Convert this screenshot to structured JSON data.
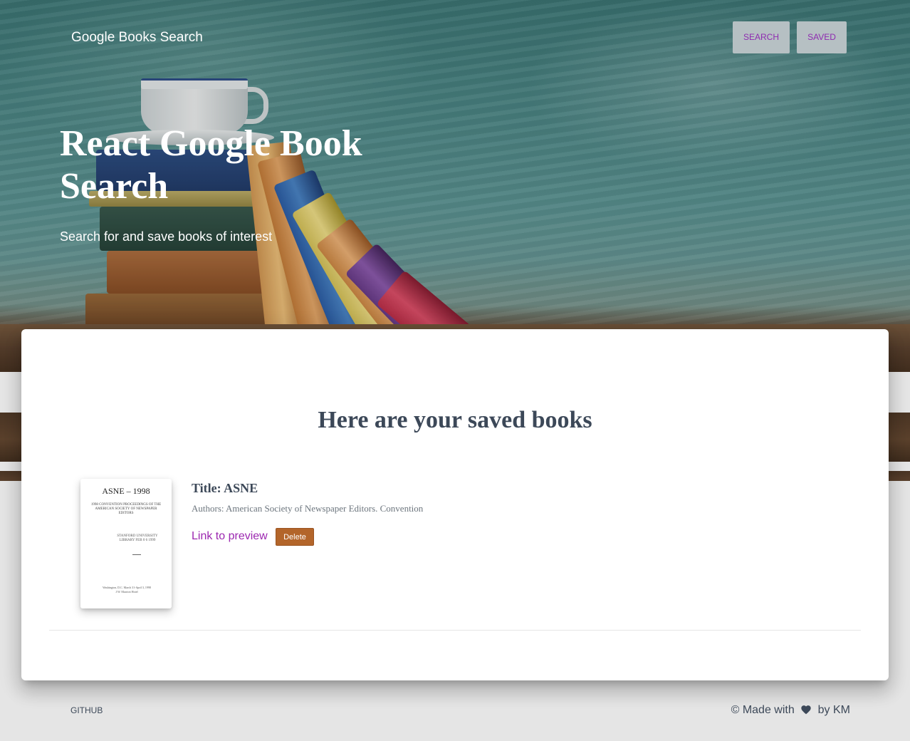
{
  "nav": {
    "brand": "Google Books Search",
    "links": [
      {
        "label": "SEARCH"
      },
      {
        "label": "SAVED"
      }
    ]
  },
  "hero": {
    "title": "React Google Book Search",
    "subtitle": "Search for and save books of interest"
  },
  "saved": {
    "heading": "Here are your saved books",
    "books": [
      {
        "title": "Title: ASNE",
        "authors": "Authors: American Society of Newspaper Editors. Convention",
        "preview_label": "Link to preview",
        "delete_label": "Delete",
        "thumbnail": {
          "title": "ASNE – 1998",
          "subtitle": "1998 CONVENTION PROCEEDINGS OF THE AMERICAN SOCIETY OF NEWSPAPER EDITORS",
          "library_stamp": "STANFORD UNIVERSITY LIBRARY FEB 0 6 1999",
          "footer": "Washington, D.C. March 31-April 3, 1998 J.W. Marriott Hotel"
        }
      }
    ]
  },
  "footer": {
    "github_label": "GITHUB",
    "credit_prefix": "© Made with",
    "credit_suffix": "by KM",
    "heart_icon": "heart-icon"
  },
  "colors": {
    "accent": "#9c27b0",
    "heading": "#3c4858",
    "delete_button": "#b3652a",
    "nav_button_bg": "#b6c0c3"
  }
}
